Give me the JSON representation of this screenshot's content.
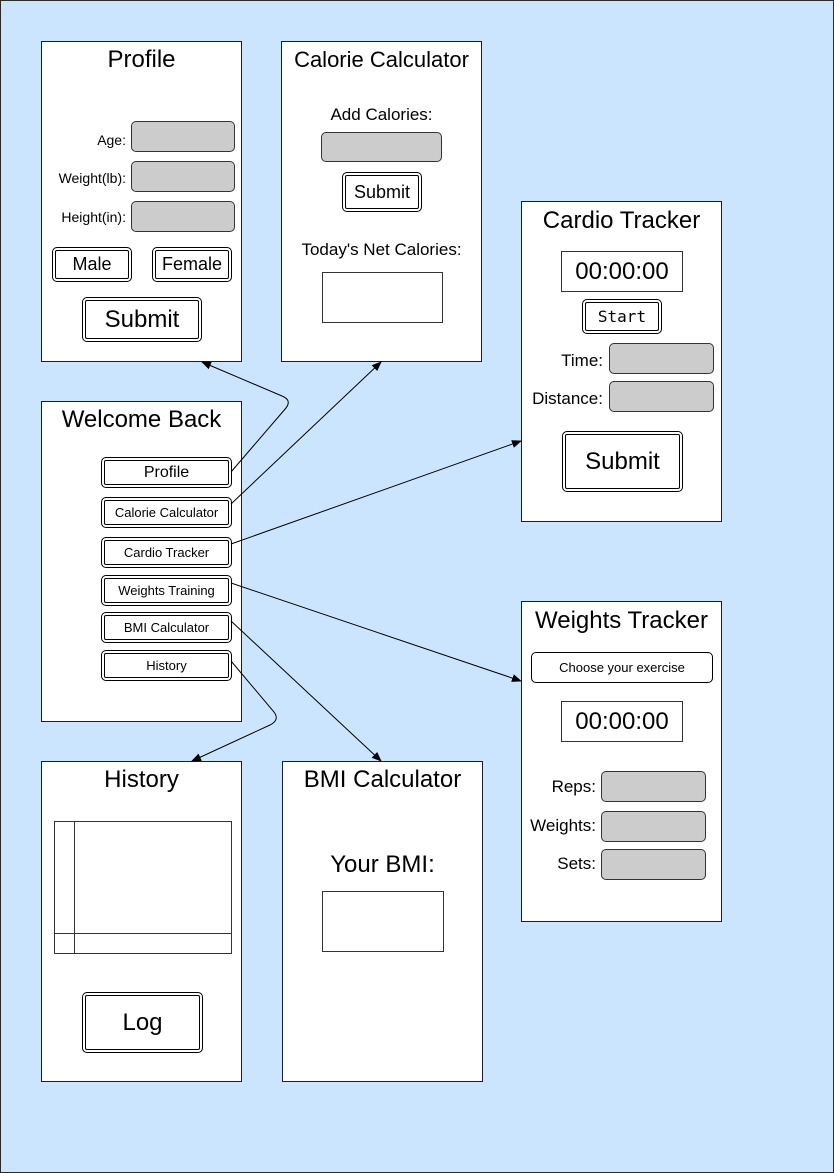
{
  "profile": {
    "title": "Profile",
    "age_label": "Age:",
    "weight_label": "Weight(lb):",
    "height_label": "Height(in):",
    "male_label": "Male",
    "female_label": "Female",
    "submit_label": "Submit"
  },
  "calorie": {
    "title": "Calorie Calculator",
    "add_label": "Add Calories:",
    "submit_label": "Submit",
    "net_label": "Today's Net Calories:"
  },
  "cardio": {
    "title": "Cardio Tracker",
    "timer": "00:00:00",
    "start_label": "Start",
    "time_label": "Time:",
    "distance_label": "Distance:",
    "submit_label": "Submit"
  },
  "welcome": {
    "title": "Welcome Back",
    "menu": [
      "Profile",
      "Calorie Calculator",
      "Cardio Tracker",
      "Weights Training",
      "BMI Calculator",
      "History"
    ]
  },
  "weights": {
    "title": "Weights Tracker",
    "choose_label": "Choose your exercise",
    "timer": "00:00:00",
    "reps_label": "Reps:",
    "weights_label": "Weights:",
    "sets_label": "Sets:"
  },
  "history": {
    "title": "History",
    "log_label": "Log"
  },
  "bmi": {
    "title": "BMI Calculator",
    "your_bmi_label": "Your BMI:"
  },
  "colors": {
    "canvas_background": "#cce5ff",
    "screen_background": "#ffffff",
    "input_fill": "#cccccc"
  }
}
